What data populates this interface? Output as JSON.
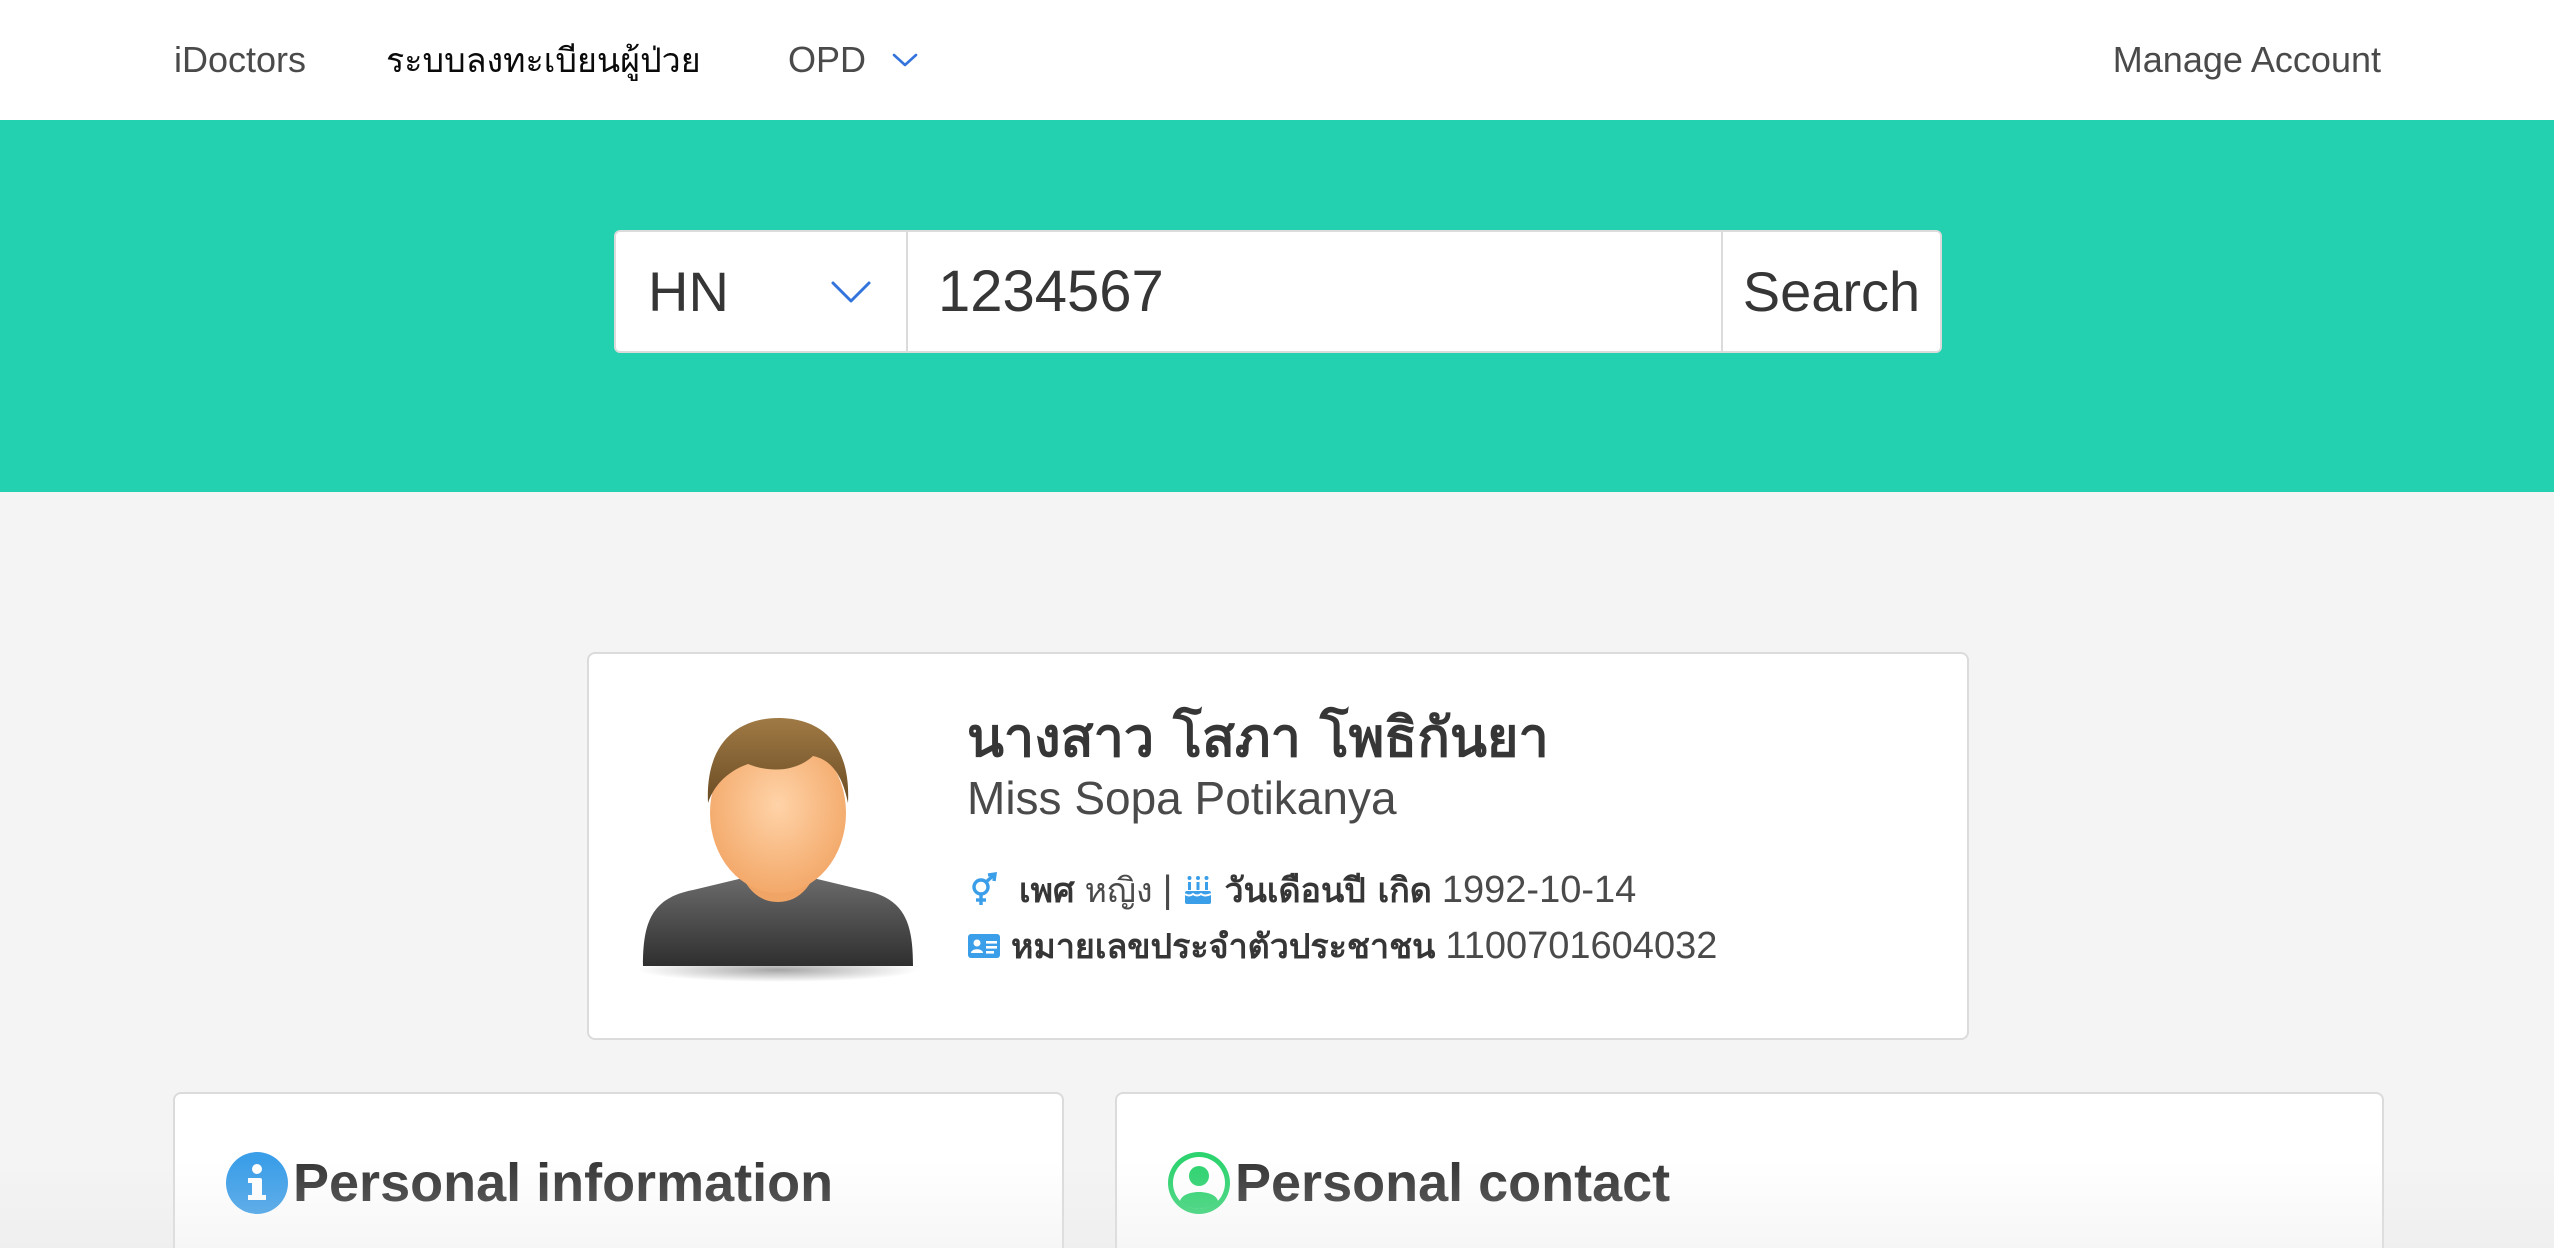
{
  "nav": {
    "brand": "iDoctors",
    "registry": "ระบบลงทะเบียนผู้ป่วย",
    "opd": "OPD",
    "account": "Manage Account"
  },
  "search": {
    "type_selected": "HN",
    "value": "1234567",
    "button_label": "Search"
  },
  "patient": {
    "name_thai": "นางสาว โสภา โพธิกันยา",
    "name_en": "Miss Sopa Potikanya",
    "gender_label": "เพศ",
    "gender_value": "หญิง",
    "separator": "|",
    "birthdate_label": "วันเดือนปี เกิด",
    "birthdate_value": "1992-10-14",
    "id_label": "หมายเลขประจำตัวประชาชน",
    "id_value": "1100701604032"
  },
  "cards": {
    "personal_information": "Personal information",
    "personal_contact": "Personal contact"
  },
  "colors": {
    "hero": "#23d0b0",
    "accent": "#3273dc",
    "info_icon": "#3b9ee8",
    "contact_icon": "#2dd36f",
    "detail_icon": "#3b9ee8"
  },
  "icons": [
    "chevron-down-icon",
    "gender-icon",
    "birthday-cake-icon",
    "id-card-icon",
    "info-circle-icon",
    "user-circle-icon",
    "avatar-silhouette"
  ]
}
